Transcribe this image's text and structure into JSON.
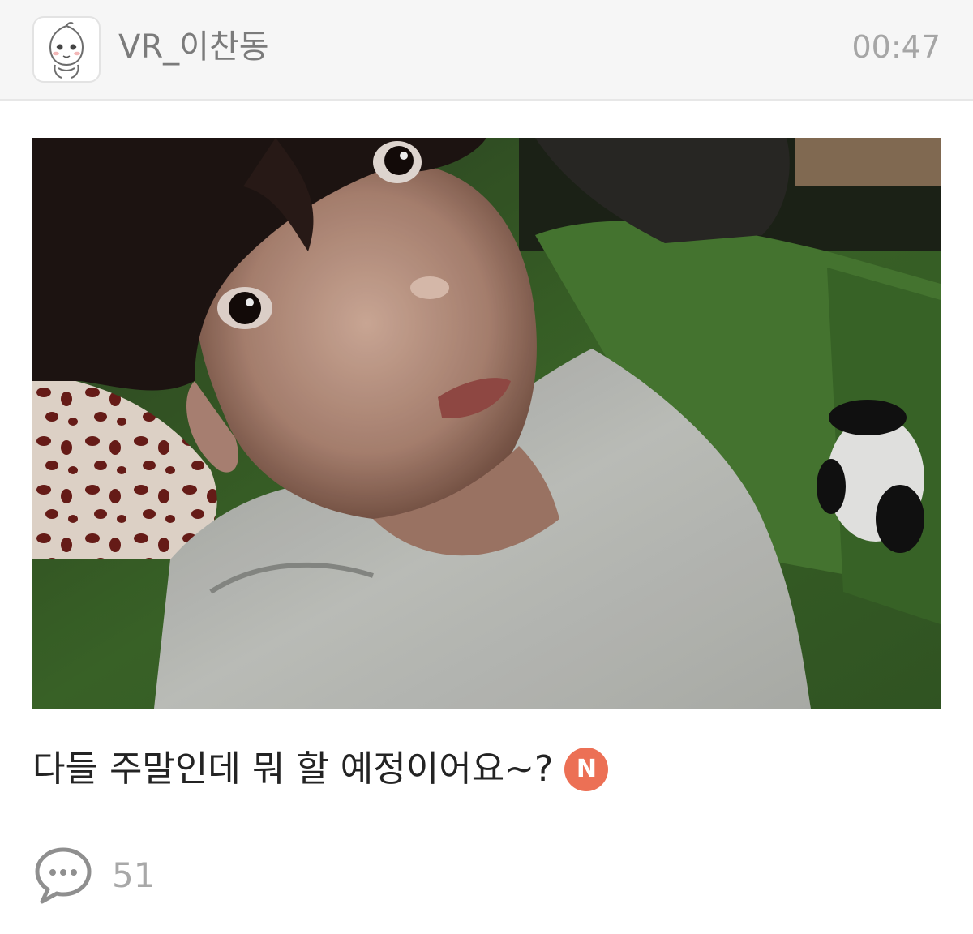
{
  "header": {
    "author_name": "VR_이찬동",
    "time": "00:47",
    "avatar_icon": "peach-character-avatar-icon"
  },
  "post": {
    "photo_icon": "selfie-photo",
    "text": "다들 주말인데 뭐 할 예정이어요~?",
    "new_badge": "N",
    "new_badge_color": "#ec7055"
  },
  "footer": {
    "comment_icon": "speech-bubble-icon",
    "comment_count": "51"
  }
}
